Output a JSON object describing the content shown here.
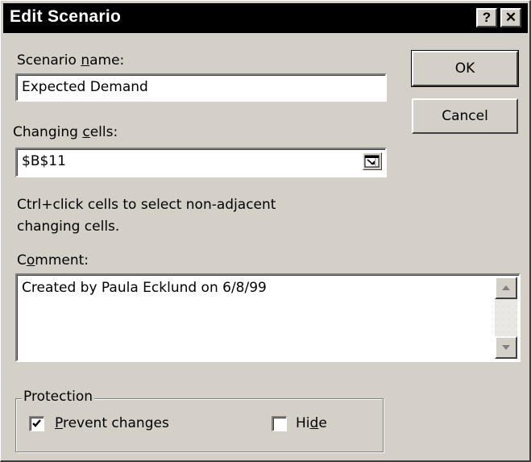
{
  "window": {
    "title": "Edit Scenario",
    "help_glyph": "?",
    "close_glyph": "✕"
  },
  "scenario_name": {
    "label_pre": "Scenario ",
    "label_key": "n",
    "label_post": "ame:",
    "value": "Expected Demand"
  },
  "changing_cells": {
    "label_pre": "Changing ",
    "label_key": "c",
    "label_post": "ells:",
    "value": "$B$11",
    "collapse_icon": "collapse-dialog-icon"
  },
  "hint": {
    "line1": "Ctrl+click cells to select non-adjacent",
    "line2": "changing cells."
  },
  "comment": {
    "label_pre": "C",
    "label_key": "o",
    "label_post": "mment:",
    "value": "Created by Paula Ecklund on 6/8/99"
  },
  "buttons": {
    "ok": "OK",
    "cancel": "Cancel"
  },
  "protection": {
    "title": "Protection",
    "prevent": {
      "key": "P",
      "rest": "revent changes",
      "checked": true
    },
    "hide": {
      "pre": "Hi",
      "key": "d",
      "post": "e",
      "checked": false
    }
  }
}
